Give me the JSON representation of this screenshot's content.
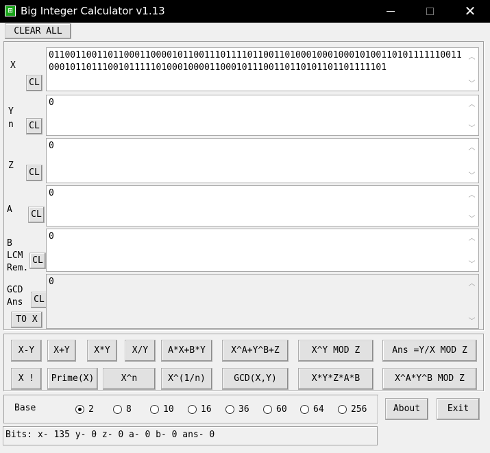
{
  "window": {
    "icon": "calculator-app-icon",
    "title": "Big Integer Calculator v1.13",
    "controls": [
      "minimize-icon",
      "maximize-icon",
      "close-icon"
    ]
  },
  "toolbar": {
    "clear_all_label": "CLEAR ALL"
  },
  "fields": {
    "x": {
      "label": "X",
      "value": "0110011001101100011000010110011101111011001101000100010001010011010111111001100010110111001011111010001000011000101110011011010110110111110​1",
      "clear_label": "CL"
    },
    "y": {
      "label": "Y\nn",
      "value": "0",
      "clear_label": "CL"
    },
    "z": {
      "label": "Z",
      "value": "0",
      "clear_label": "CL"
    },
    "a": {
      "label": "A",
      "value": "0",
      "clear_label": "CL"
    },
    "b": {
      "label": "B\nLCM\nRem.",
      "value": "0",
      "clear_label": "CL"
    },
    "ans": {
      "label": "GCD\nAns",
      "value": "0",
      "clear_label": "CL",
      "to_x_label": "TO X"
    }
  },
  "operations": {
    "row1": [
      "X-Y",
      "X+Y",
      "X*Y",
      "X/Y",
      "A*X+B*Y",
      "X^A+Y^B+Z",
      "X^Y MOD Z",
      "Ans =Y/X MOD Z"
    ],
    "row2": [
      "X !",
      "Prime(X)",
      "X^n",
      "X^(1/n)",
      "GCD(X,Y)",
      "X*Y*Z*A*B",
      "X^A*Y^B MOD Z"
    ]
  },
  "base": {
    "label": "Base",
    "options": [
      "2",
      "8",
      "10",
      "16",
      "36",
      "60",
      "64",
      "256"
    ],
    "selected": "2"
  },
  "actions": {
    "about_label": "About",
    "exit_label": "Exit"
  },
  "status": {
    "text": "Bits: x- 135 y- 0 z- 0 a- 0 b- 0 ans- 0"
  }
}
